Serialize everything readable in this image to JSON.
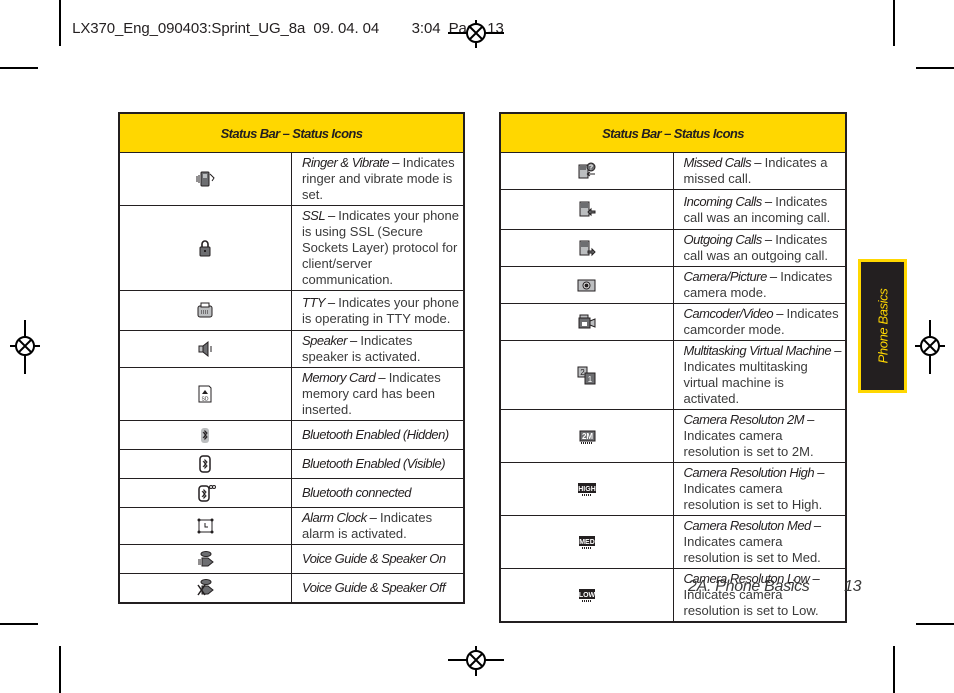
{
  "print_header": {
    "file_label": "LX370_Eng_090403:Sprint_UG_8a  09. 04. 04",
    "time_page": "3:04  Page 13"
  },
  "left_table": {
    "title": "Status Bar – Status Icons",
    "rows": [
      {
        "icon": "ringer-vibrate-icon",
        "name": "Ringer & Vibrate –",
        "desc": " Indicates ringer and vibrate mode is set."
      },
      {
        "icon": "ssl-lock-icon",
        "name": "SSL –",
        "desc": " Indicates your phone is using SSL (Secure Sockets Layer) protocol for client/server communication."
      },
      {
        "icon": "tty-icon",
        "name": "TTY –",
        "desc": " Indicates your phone is operating in TTY mode."
      },
      {
        "icon": "speaker-icon",
        "name": "Speaker –",
        "desc": " Indicates speaker is activated."
      },
      {
        "icon": "memory-card-icon",
        "name": "Memory Card –",
        "desc": " Indicates memory card has been inserted."
      },
      {
        "icon": "bluetooth-hidden-icon",
        "name": "Bluetooth Enabled (Hidden)",
        "desc": ""
      },
      {
        "icon": "bluetooth-visible-icon",
        "name": "Bluetooth Enabled (Visible)",
        "desc": ""
      },
      {
        "icon": "bluetooth-connected-icon",
        "name": "Bluetooth connected",
        "desc": ""
      },
      {
        "icon": "alarm-clock-icon",
        "name": "Alarm Clock –",
        "desc": " Indicates alarm is activated."
      },
      {
        "icon": "voice-guide-speaker-on-icon",
        "name": "Voice Guide & Speaker On",
        "desc": ""
      },
      {
        "icon": "voice-guide-speaker-off-icon",
        "name": "Voice Guide & Speaker Off",
        "desc": ""
      }
    ]
  },
  "right_table": {
    "title": "Status Bar – Status Icons",
    "rows": [
      {
        "icon": "missed-calls-icon",
        "name": "Missed Calls –",
        "desc": " Indicates a missed call."
      },
      {
        "icon": "incoming-calls-icon",
        "name": "Incoming Calls –",
        "desc": " Indicates call was an incoming call."
      },
      {
        "icon": "outgoing-calls-icon",
        "name": "Outgoing Calls –",
        "desc": " Indicates call was an outgoing call."
      },
      {
        "icon": "camera-picture-icon",
        "name": "Camera/Picture –",
        "desc": " Indicates camera mode."
      },
      {
        "icon": "camcorder-video-icon",
        "name": "Camcoder/Video –",
        "desc": " Indicates camcorder mode."
      },
      {
        "icon": "multitasking-vm-icon",
        "name": "Multitasking Virtual Machine –",
        "desc": " Indicates multitasking virtual machine is activated."
      },
      {
        "icon": "camera-resolution-2m-icon",
        "name": "Camera Resoluton 2M –",
        "desc": " Indicates camera resolution is set to 2M."
      },
      {
        "icon": "camera-resolution-high-icon",
        "name": "Camera Resolution High –",
        "desc": " Indicates camera resolution is set to High."
      },
      {
        "icon": "camera-resolution-med-icon",
        "name": "Camera Resoluton Med –",
        "desc": " Indicates camera resolution is set to Med."
      },
      {
        "icon": "camera-resolution-low-icon",
        "name": "Camera Resoluton Low –",
        "desc": " Indicates camera resolution is set to Low."
      }
    ]
  },
  "side_tab": {
    "label": "Phone Basics"
  },
  "footer": {
    "section": "2A. Phone Basics",
    "page_number": "13"
  },
  "colors": {
    "accent_yellow": "#ffd700",
    "ink": "#231f20"
  }
}
